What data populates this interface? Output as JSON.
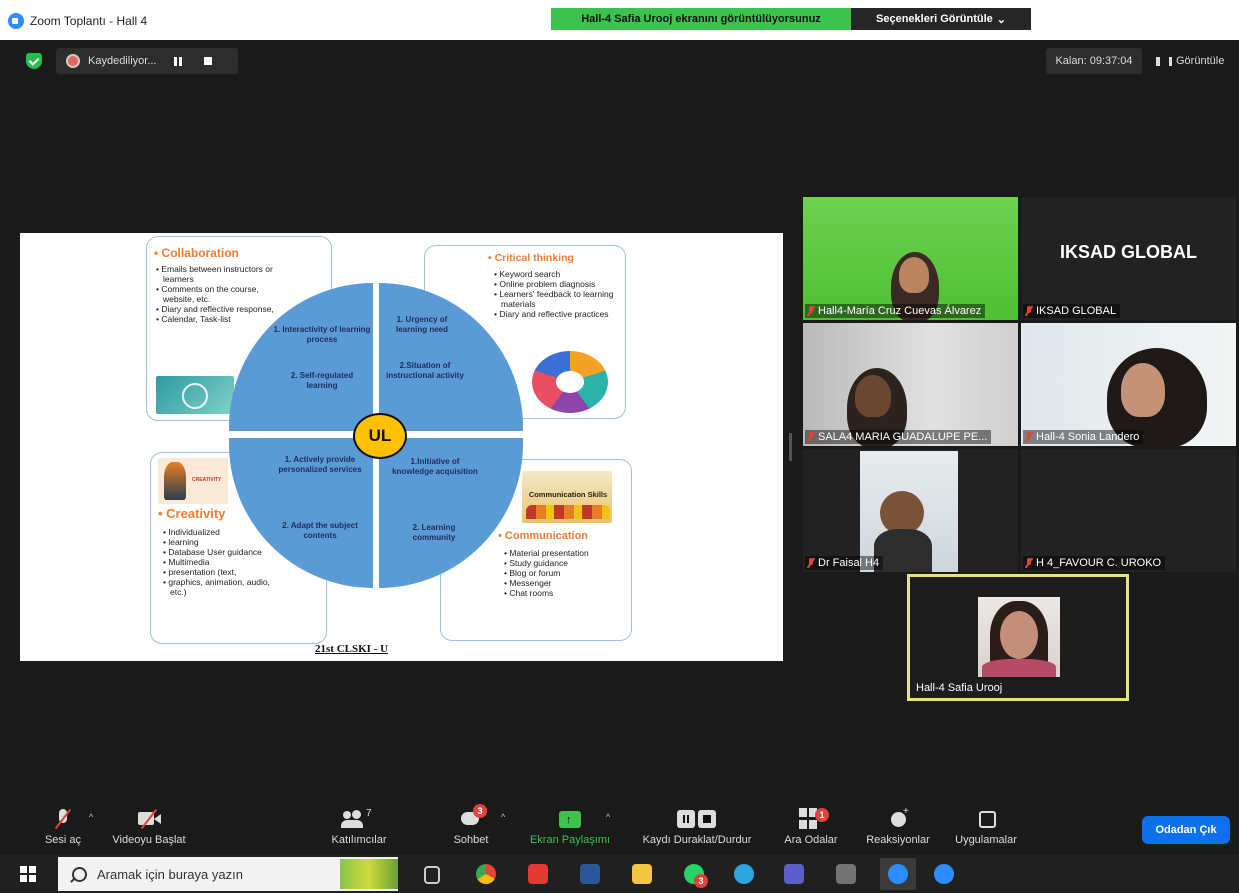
{
  "window": {
    "title": "Zoom Toplantı - Hall 4"
  },
  "share_banner": {
    "text": "Hall-4 Safia Urooj ekranını görüntülüyorsunuz"
  },
  "view_options": {
    "label": "Seçenekleri Görüntüle"
  },
  "recording": {
    "label": "Kaydediliyor..."
  },
  "timer": {
    "label": "Kalan: 09:37:04"
  },
  "view_button": {
    "label": "Görüntüle"
  },
  "slide": {
    "collab": {
      "title": "• Collaboration",
      "items": [
        "Emails between instructors or learners",
        "Comments on the course, website, etc.",
        "Diary and reflective response,",
        "Calendar, Task-list"
      ]
    },
    "critical": {
      "title": "• Critical thinking",
      "items": [
        "Keyword search",
        "Online problem diagnosis",
        "Learners' feedback to learning materials",
        "Diary and reflective practices"
      ]
    },
    "creativity": {
      "title": "• Creativity",
      "thumb_label": "CREATIVITY",
      "items": [
        "Individualized",
        "learning",
        "Database User guidance",
        "Multimedia",
        "presentation (text,",
        "graphics, animation, audio, etc.)"
      ]
    },
    "communication": {
      "title": "• Communication",
      "thumb_label": "Communication Skills",
      "items": [
        "Material presentation",
        "Study guidance",
        "Blog or forum",
        "Messenger",
        "Chat rooms"
      ]
    },
    "q1": {
      "a": "1. Interactivity of learning process",
      "b": "2. Self-regulated learning"
    },
    "q2": {
      "a": "1. Urgency of learning need",
      "b": "2.Situation of instructional activity"
    },
    "q3": {
      "a": "1. Actively provide personalized services",
      "b": "2. Adapt the subject contents"
    },
    "q4": {
      "a": "1.Initiative of knowledge acquisition",
      "b": "2. Learning community"
    },
    "center": "UL",
    "caption": "21st CLSKI - U"
  },
  "participants": [
    {
      "name": "Hall4-María Cruz Cuevas Álvarez"
    },
    {
      "name": "IKSAD GLOBAL",
      "display_text": "IKSAD GLOBAL"
    },
    {
      "name": "SALA4 MARIA GUADALUPE PE..."
    },
    {
      "name": "Hall-4 Sonia Landero"
    },
    {
      "name": "Dr Faisal H4"
    },
    {
      "name": "H 4_FAVOUR C. UROKO"
    }
  ],
  "active_speaker": {
    "name": "Hall-4 Safia Urooj"
  },
  "toolbar": {
    "unmute": "Sesi aç",
    "start_video": "Videoyu Başlat",
    "participants": "Katılımcılar",
    "participants_count": "7",
    "chat": "Sohbet",
    "chat_badge": "3",
    "share": "Ekran Paylaşımı",
    "record": "Kaydı Duraklat/Durdur",
    "breakout": "Ara Odalar",
    "breakout_badge": "1",
    "reactions": "Reaksiyonlar",
    "apps": "Uygulamalar",
    "leave": "Odadan Çık"
  },
  "taskbar": {
    "search_placeholder": "Aramak için buraya yazın",
    "whatsapp_badge": "3"
  },
  "colors": {
    "share_green": "#3bc34e",
    "zoom_blue": "#0e71eb",
    "active_border": "#e6e57c",
    "slide_blue": "#5b9bd5",
    "orange": "#ed7d31"
  }
}
